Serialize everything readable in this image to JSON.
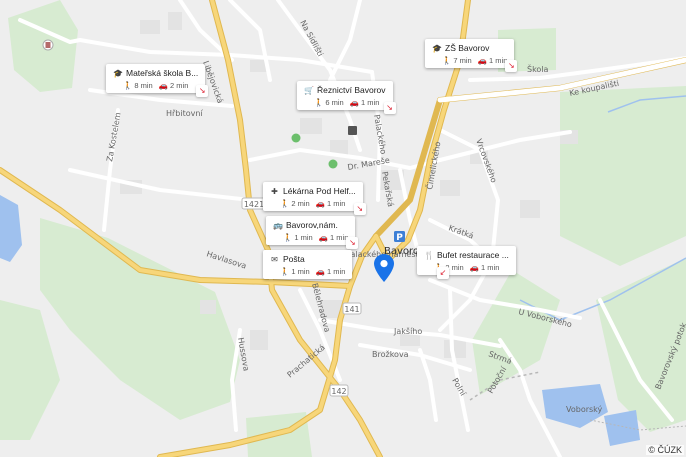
{
  "colors": {
    "background": "#eeeeee",
    "green": "#d7ebd1",
    "water": "#9fc1ee",
    "major_road": "#f7d67a",
    "major_road_casing": "#e0b850",
    "minor_road": "#ffffff",
    "pin": "#1a73e8"
  },
  "places": {
    "town": "Bavorov",
    "pond": "Voborský"
  },
  "road_numbers": [
    "1421",
    "141",
    "142"
  ],
  "streets": [
    "Libějovická",
    "Hřbitovní",
    "Za Kostelem",
    "Na Sídlišti",
    "Ke koupališti",
    "Dr. Mareše",
    "Palackého",
    "Pekařská",
    "Vrcovského",
    "Čimelického",
    "Krátká",
    "Havlasova",
    "Bělehradova",
    "Hussova",
    "Prachatická",
    "Jakšího",
    "Brožkova",
    "Strmá",
    "Polní",
    "Potoční",
    "U Voborského",
    "Bavorovský potok",
    "Palackého náměstí"
  ],
  "small_labels": [
    "Škola"
  ],
  "cards": [
    {
      "id": "materska-skola",
      "icon": "school-icon",
      "title": "Mateřská škola B...",
      "walk": "8 min",
      "drive": "2 min"
    },
    {
      "id": "zs-bavorov",
      "icon": "school-icon",
      "title": "ZŠ Bavorov",
      "walk": "7 min",
      "drive": "1 min"
    },
    {
      "id": "reznictvi",
      "icon": "cart-icon",
      "title": "Řeznictví Bavorov",
      "walk": "6 min",
      "drive": "1 min"
    },
    {
      "id": "lekarna",
      "icon": "pharmacy-icon",
      "title": "Lékárna Pod Helf...",
      "walk": "2 min",
      "drive": "1 min"
    },
    {
      "id": "bavorov-nam",
      "icon": "bus-icon",
      "title": "Bavorov,nám.",
      "walk": "1 min",
      "drive": "1 min"
    },
    {
      "id": "posta",
      "icon": "post-icon",
      "title": "Pošta",
      "walk": "1 min",
      "drive": "1 min"
    },
    {
      "id": "bufet",
      "icon": "restaurant-icon",
      "title": "Bufet restaurace ...",
      "walk": "2 min",
      "drive": "1 min"
    }
  ],
  "attribution": "© ČÚZK"
}
